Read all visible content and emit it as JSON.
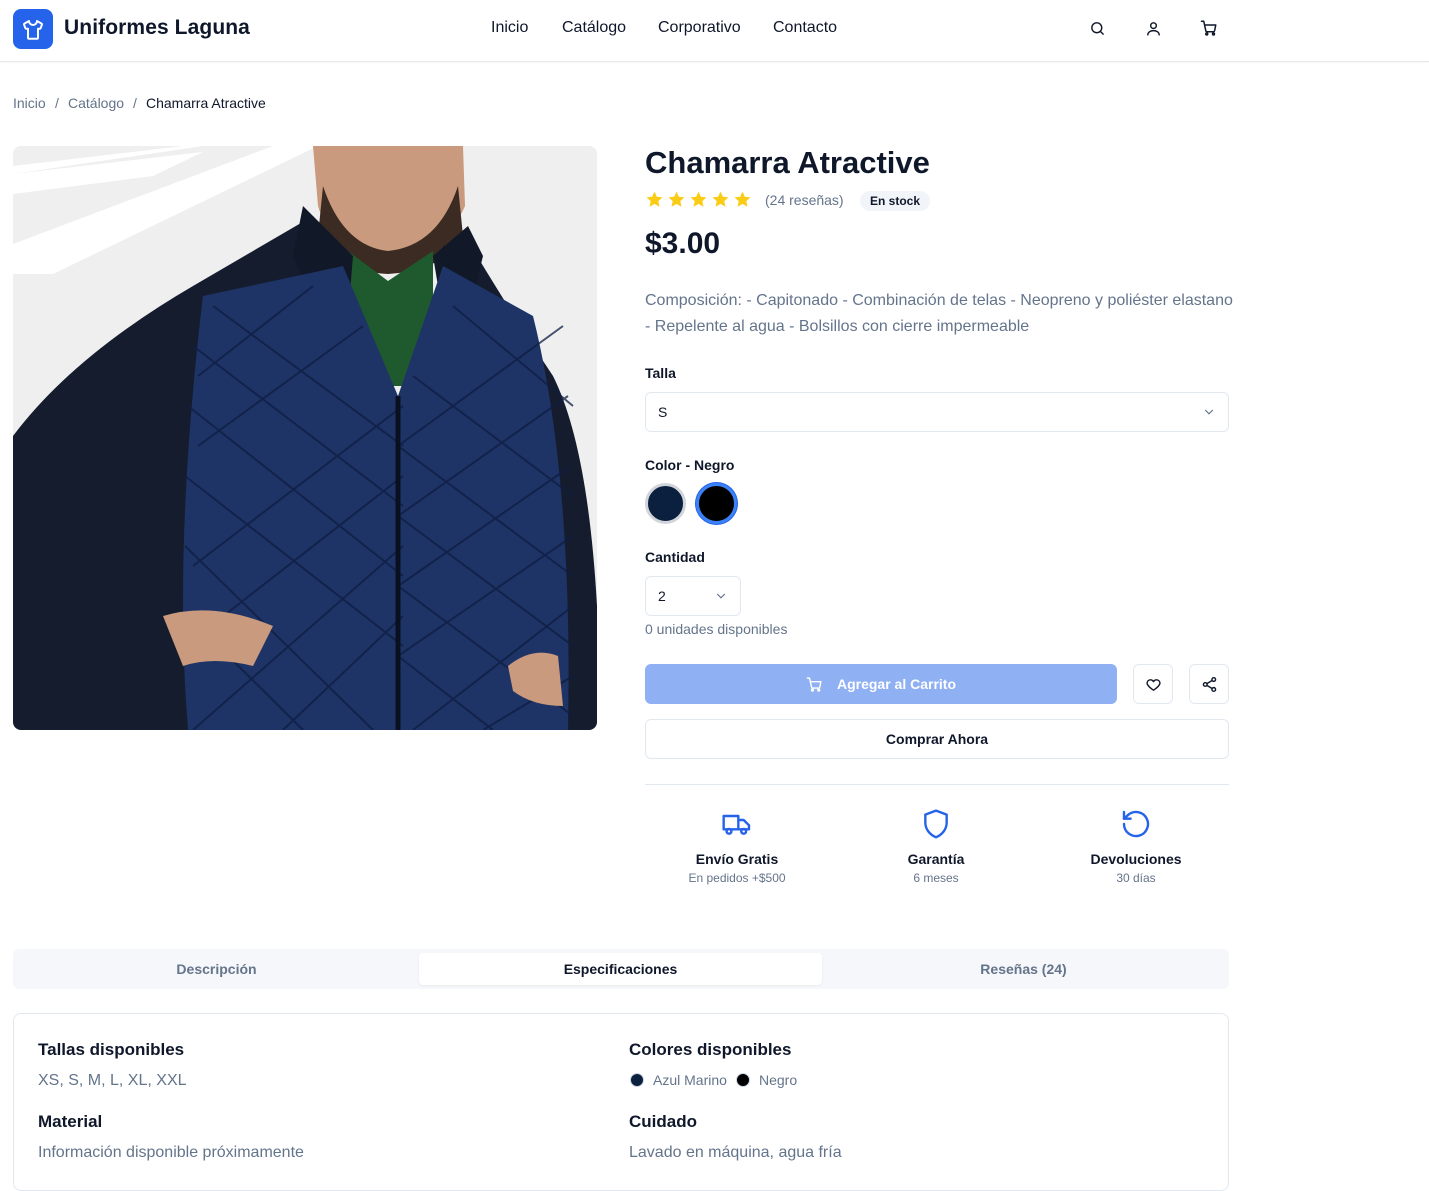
{
  "header": {
    "brand": "Uniformes Laguna",
    "nav": [
      "Inicio",
      "Catálogo",
      "Corporativo",
      "Contacto"
    ],
    "icons": [
      "search-icon",
      "user-icon",
      "cart-icon"
    ]
  },
  "breadcrumb": [
    "Inicio",
    "Catálogo",
    "Chamarra Atractive"
  ],
  "product": {
    "title": "Chamarra Atractive",
    "rating": 5,
    "reviews_label": "(24 reseñas)",
    "stock_label": "En stock",
    "price": "$3.00",
    "description": "Composición: - Capitonado - Combinación de telas - Neopreno y poliéster elastano - Repelente al agua - Bolsillos con cierre impermeable",
    "size_label": "Talla",
    "size_value": "S",
    "color_label": "Color - Negro",
    "colors": [
      {
        "name": "Azul Marino",
        "hex": "#0b1f3f",
        "selected": false
      },
      {
        "name": "Negro",
        "hex": "#000000",
        "selected": true
      }
    ],
    "quantity_label": "Cantidad",
    "quantity_value": "2",
    "available_label": "0 unidades disponibles",
    "add_to_cart_label": "Agregar al Carrito",
    "buy_now_label": "Comprar Ahora"
  },
  "features": [
    {
      "title": "Envío Gratis",
      "subtitle": "En pedidos +$500",
      "icon": "truck-icon"
    },
    {
      "title": "Garantía",
      "subtitle": "6 meses",
      "icon": "shield-icon"
    },
    {
      "title": "Devoluciones",
      "subtitle": "30 días",
      "icon": "rotate-ccw-icon"
    }
  ],
  "tabs": [
    {
      "label": "Descripción",
      "active": false
    },
    {
      "label": "Especificaciones",
      "active": true
    },
    {
      "label": "Reseñas (24)",
      "active": false
    }
  ],
  "specs": {
    "sizes_title": "Tallas disponibles",
    "sizes_value": "XS, S, M, L, XL, XXL",
    "colors_title": "Colores disponibles",
    "colors": [
      "Azul Marino",
      "Negro"
    ],
    "material_title": "Material",
    "material_value": "Información disponible próximamente",
    "care_title": "Cuidado",
    "care_value": "Lavado en máquina, agua fría"
  },
  "colors": {
    "accent": "#2563eb",
    "cart_button_disabled": "#8fb0f3",
    "star": "#facc15"
  }
}
